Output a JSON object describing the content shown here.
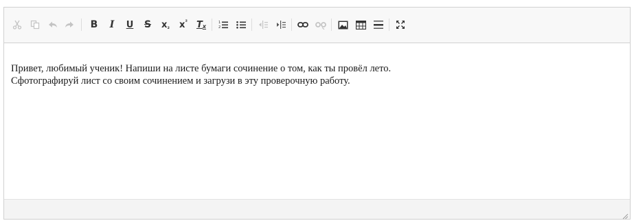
{
  "toolbar": {
    "buttons": [
      {
        "name": "cut-icon",
        "glyph": "✂",
        "enabled": false
      },
      {
        "name": "copy-icon",
        "glyph": "⎘",
        "enabled": false
      },
      {
        "name": "undo-icon",
        "glyph": "↶",
        "enabled": false
      },
      {
        "name": "redo-icon",
        "glyph": "↷",
        "enabled": false
      },
      {
        "name": "bold-icon",
        "glyph": "B",
        "enabled": true
      },
      {
        "name": "italic-icon",
        "glyph": "I",
        "enabled": true
      },
      {
        "name": "underline-icon",
        "glyph": "U",
        "enabled": true
      },
      {
        "name": "strikethrough-icon",
        "glyph": "S",
        "enabled": true
      },
      {
        "name": "subscript-icon",
        "glyph": "x₂",
        "enabled": true
      },
      {
        "name": "superscript-icon",
        "glyph": "x²",
        "enabled": true
      },
      {
        "name": "remove-format-icon",
        "glyph": "Tₓ",
        "enabled": true
      },
      {
        "name": "numbered-list-icon",
        "glyph": "⒈≡",
        "enabled": true
      },
      {
        "name": "bulleted-list-icon",
        "glyph": "•≡",
        "enabled": true
      },
      {
        "name": "outdent-icon",
        "glyph": "⇤",
        "enabled": false
      },
      {
        "name": "indent-icon",
        "glyph": "⇥",
        "enabled": true
      },
      {
        "name": "link-icon",
        "glyph": "∞",
        "enabled": true
      },
      {
        "name": "unlink-icon",
        "glyph": "⊘",
        "enabled": false
      },
      {
        "name": "image-icon",
        "glyph": "▣",
        "enabled": true
      },
      {
        "name": "table-icon",
        "glyph": "⊞",
        "enabled": true
      },
      {
        "name": "horizontal-line-icon",
        "glyph": "≣",
        "enabled": true
      },
      {
        "name": "maximize-icon",
        "glyph": "⛶",
        "enabled": true
      }
    ]
  },
  "content": {
    "line1": "Привет, любимый ученик! Напиши на листе бумаги сочинение о том, как ты провёл лето.",
    "line2": "Сфотографируй лист со своим сочинением и загрузи в эту проверочную работу."
  },
  "colors": {
    "toolbar_bg": "#f8f8f8",
    "border": "#d1d1d1",
    "icon_active": "#333333",
    "icon_disabled": "#c4c4c4",
    "text": "#1a1a1a"
  }
}
